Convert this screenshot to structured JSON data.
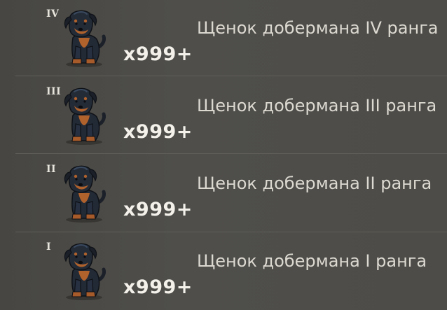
{
  "items": [
    {
      "rank": "IV",
      "quantity": "x999+",
      "name": "Щенок добермана IV ранга",
      "icon": "doberman-puppy-icon"
    },
    {
      "rank": "III",
      "quantity": "x999+",
      "name": "Щенок добермана III ранга",
      "icon": "doberman-puppy-icon"
    },
    {
      "rank": "II",
      "quantity": "x999+",
      "name": "Щенок добермана II ранга",
      "icon": "doberman-puppy-icon"
    },
    {
      "rank": "I",
      "quantity": "x999+",
      "name": "Щенок добермана I ранга",
      "icon": "doberman-puppy-icon"
    }
  ],
  "colors": {
    "background": "#4d4c48",
    "divider": "#5f5e59",
    "name_text": "#dcd9d1",
    "quantity_text": "#f3f1ea",
    "puppy_body": "#1f2530",
    "puppy_tan": "#b0622d"
  }
}
